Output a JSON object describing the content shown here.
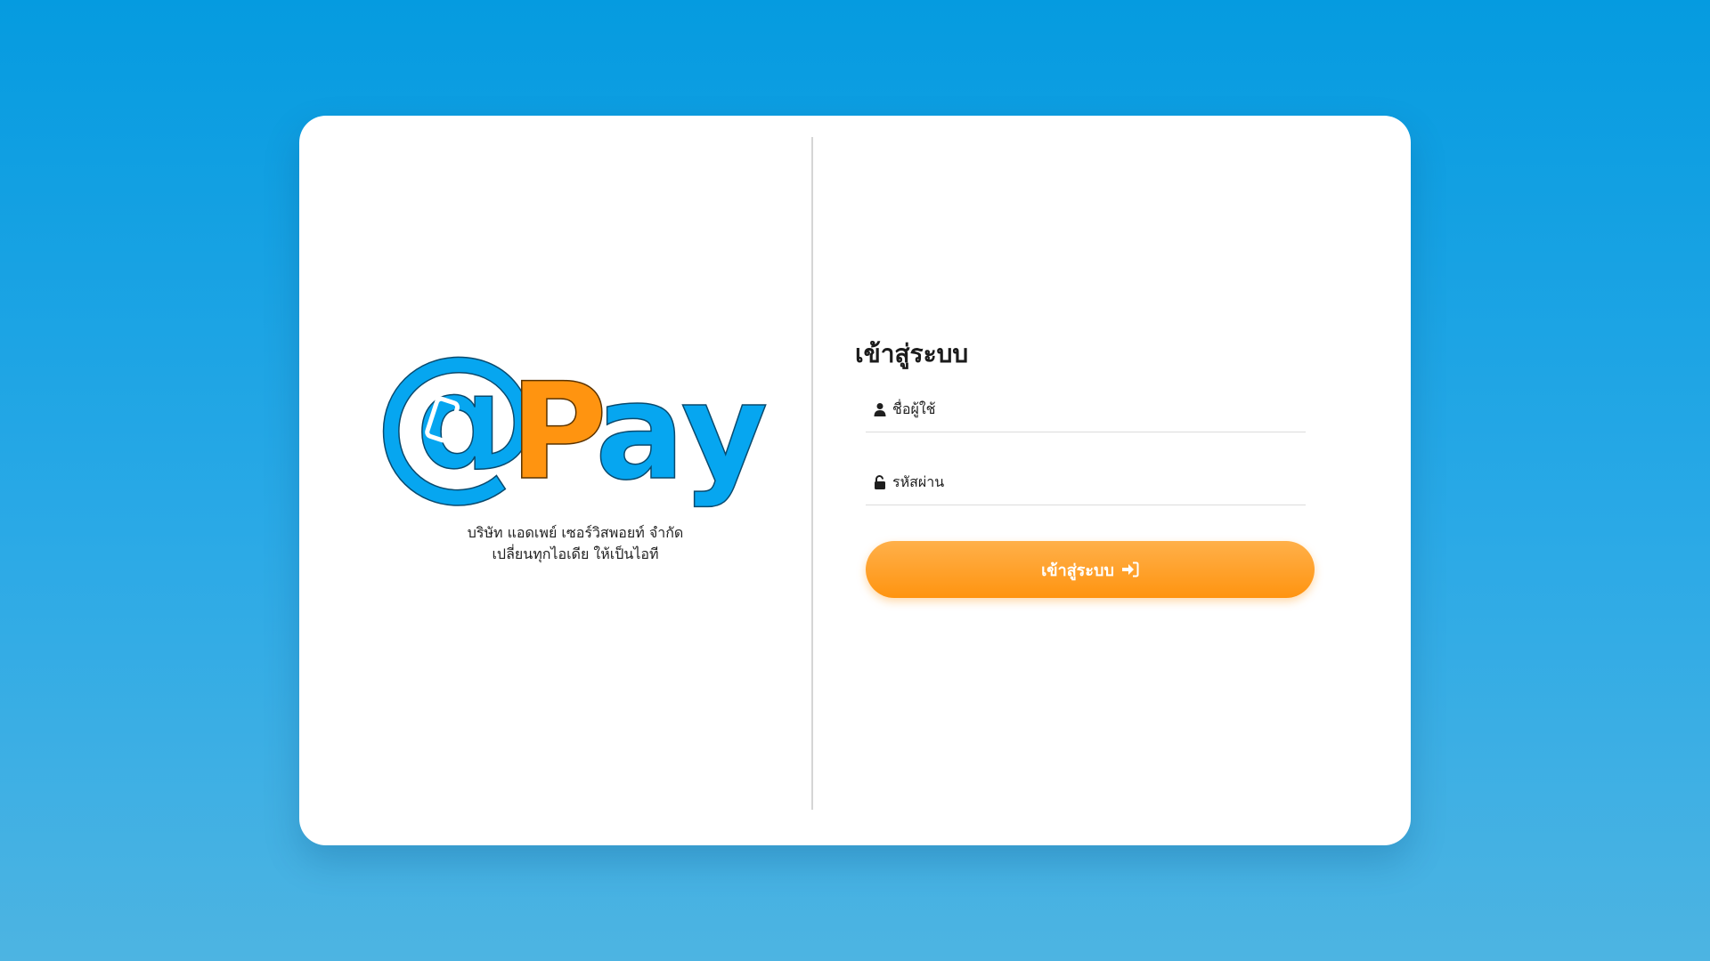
{
  "colors": {
    "background_top": "#059be0",
    "background_bottom": "#4db4e2",
    "brand_blue": "#06a6f0",
    "brand_orange": "#ff9410",
    "button_orange": "#ff9a1a"
  },
  "brand": {
    "logo_at": "@",
    "logo_p": "P",
    "logo_ay": "ay",
    "company_name": "บริษัท แอดเพย์ เซอร์วิสพอยท์ จำกัด",
    "slogan": "เปลี่ยนทุกไอเดีย ให้เป็นไอที"
  },
  "login": {
    "title": "เข้าสู่ระบบ",
    "username": {
      "placeholder": "ชื่อผู้ใช้",
      "icon": "user-icon"
    },
    "password": {
      "placeholder": "รหัสผ่าน",
      "icon": "unlock-icon"
    },
    "submit_label": "เข้าสู่ระบบ",
    "submit_icon": "sign-in-icon"
  }
}
